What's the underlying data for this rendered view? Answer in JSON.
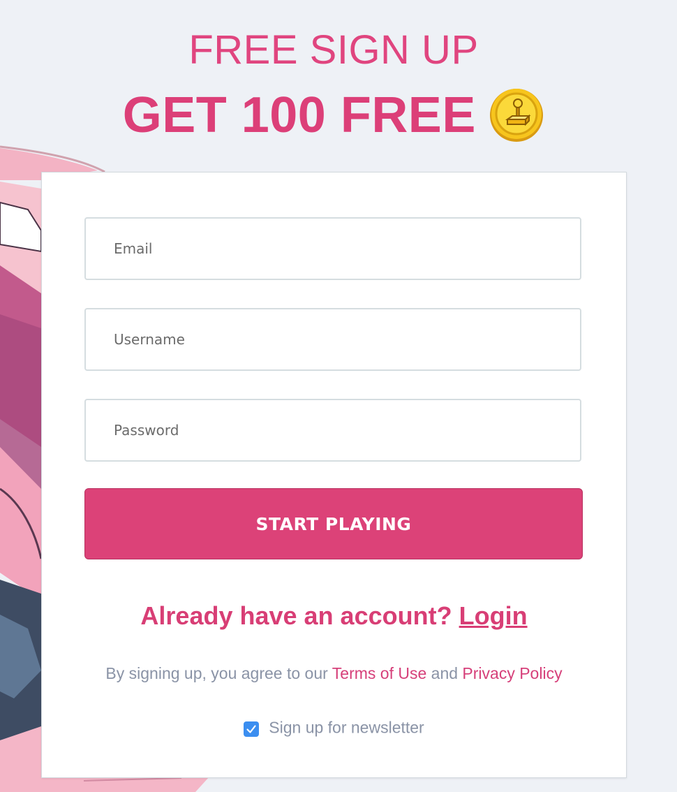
{
  "header": {
    "line1": "FREE SIGN UP",
    "line2": "GET 100 FREE",
    "coin_icon": "joystick-coin-icon"
  },
  "form": {
    "email_placeholder": "Email",
    "username_placeholder": "Username",
    "password_placeholder": "Password",
    "submit_label": "START PLAYING"
  },
  "account": {
    "prompt": "Already have an account?",
    "login_label": "Login"
  },
  "legal": {
    "prefix": "By signing up, you agree to our",
    "terms_label": "Terms of Use",
    "joiner": "and",
    "privacy_label": "Privacy Policy"
  },
  "newsletter": {
    "label": "Sign up for newsletter",
    "checked": true
  },
  "colors": {
    "accent": "#dc4278",
    "checkbox": "#3b8ef0",
    "muted_text": "#8a93a6",
    "background": "#eef1f6"
  }
}
